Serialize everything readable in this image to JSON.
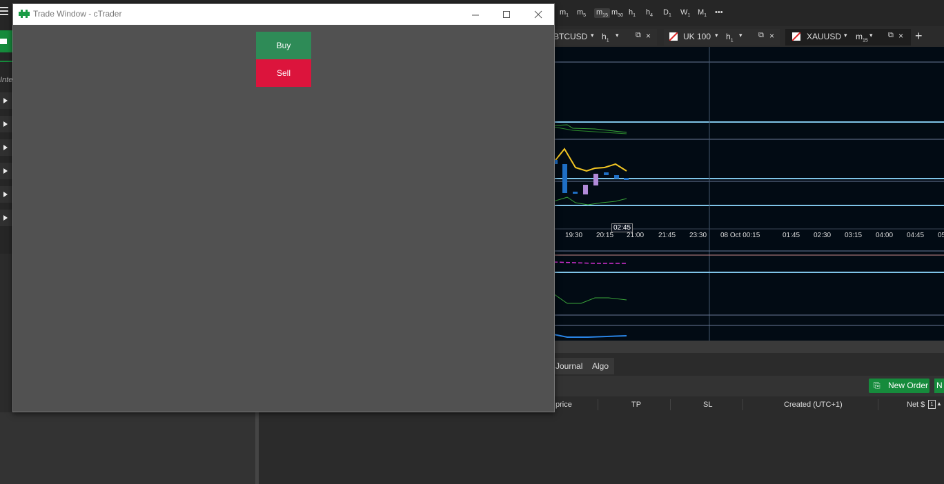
{
  "background_app": {
    "timeframes": [
      {
        "base": "m",
        "sub": "1"
      },
      {
        "base": "m",
        "sub": "5"
      },
      {
        "base": "m",
        "sub": "15",
        "active": true
      },
      {
        "base": "m",
        "sub": "30"
      },
      {
        "base": "h",
        "sub": "1"
      },
      {
        "base": "h",
        "sub": "4"
      },
      {
        "base": "D",
        "sub": "1"
      },
      {
        "base": "W",
        "sub": "1"
      },
      {
        "base": "M",
        "sub": "1"
      }
    ],
    "more_label": "•••",
    "chart_tabs": [
      {
        "symbol": "BTCUSD",
        "tf_base": "h",
        "tf_sub": "1"
      },
      {
        "symbol": "UK 100",
        "tf_base": "h",
        "tf_sub": "1"
      },
      {
        "symbol": "XAUUSD",
        "tf_base": "m",
        "tf_sub": "15"
      }
    ],
    "add_tab_label": "+",
    "left_partial_text": "Inter",
    "time_axis": [
      "19:30",
      "20:15",
      "21:00",
      "21:45",
      "23:30",
      "08 Oct 00:15",
      "01:45",
      "02:30",
      "03:15",
      "04:00",
      "04:45",
      "05"
    ],
    "crosshair_time": "02:45",
    "bottom_tabs": [
      "Journal",
      "Algo"
    ],
    "new_order_label": "New Order",
    "new_order_partial": "N",
    "columns": [
      "price",
      "TP",
      "SL",
      "Created (UTC+1)",
      "Net $"
    ],
    "net_badge": "1",
    "colors": {
      "chart_bg": "#020b14",
      "buy": "#2e8b57",
      "sell": "#dc143c",
      "new_order": "#168b3c"
    }
  },
  "trade_window": {
    "title": "Trade Window - cTrader",
    "buy_label": "Buy",
    "sell_label": "Sell"
  }
}
